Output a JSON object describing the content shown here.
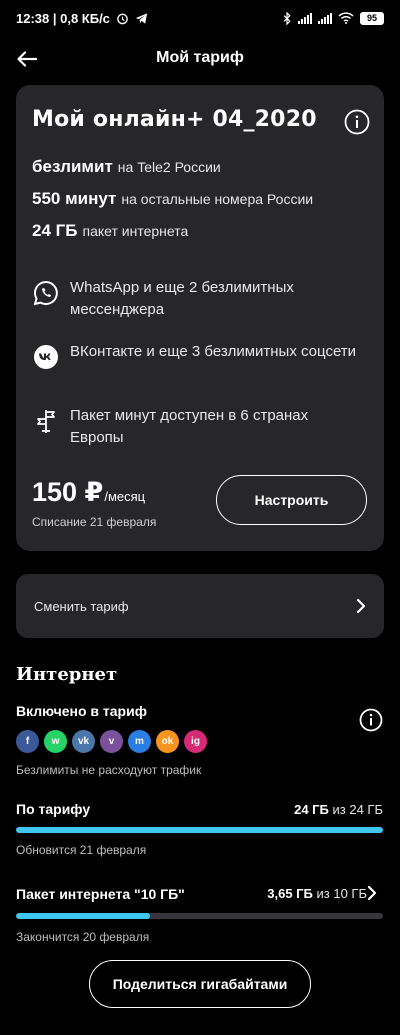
{
  "status_bar": {
    "time_speed": "12:38 | 0,8 КБ/с",
    "battery": "95"
  },
  "app_bar": {
    "title": "Мой тариф"
  },
  "plan": {
    "name": "Мой онлайн+ 04_2020",
    "features": [
      {
        "value": "безлимит",
        "desc": "на Tele2 России"
      },
      {
        "value": "550 минут",
        "desc": "на остальные номера России"
      },
      {
        "value": "24 ГБ",
        "desc": "пакет интернета"
      }
    ],
    "perks": [
      {
        "icon": "whatsapp-icon",
        "text": "WhatsApp и еще 2 безлимитных мессенджера"
      },
      {
        "icon": "vk-icon",
        "text": "ВКонтакте и еще 3 безлимитных соцсети"
      },
      {
        "icon": "flag-signpost-icon",
        "text": "Пакет минут доступен в 6 странах Европы"
      }
    ],
    "price": "150 ₽",
    "price_unit": "/месяц",
    "charge_date": "Списание 21 февраля",
    "configure_label": "Настроить"
  },
  "change_tariff": {
    "label": "Сменить тариф"
  },
  "internet": {
    "section_title": "Интернет",
    "included_title": "Включено в тариф",
    "socials": [
      {
        "name": "facebook",
        "glyph": "f",
        "color": "#3b5998"
      },
      {
        "name": "whatsapp",
        "glyph": "w",
        "color": "#25d366"
      },
      {
        "name": "vk",
        "glyph": "vk",
        "color": "#4a76a8"
      },
      {
        "name": "viber",
        "glyph": "v",
        "color": "#7b519d"
      },
      {
        "name": "messenger",
        "glyph": "m",
        "color": "#2a7de1"
      },
      {
        "name": "odnoklassniki",
        "glyph": "ok",
        "color": "#f7931e"
      },
      {
        "name": "instagram",
        "glyph": "ig",
        "color": "#d62976"
      }
    ],
    "note": "Безлимиты не расходуют трафик",
    "tariff_usage": {
      "title": "По тарифу",
      "used": "24 ГБ",
      "of_label": "из 24 ГБ",
      "fill_fraction": 1.0,
      "note": "Обновится 21 февраля"
    },
    "package_usage": {
      "title": "Пакет интернета \"10 ГБ\"",
      "used": "3,65 ГБ",
      "of_label": "из 10 ГБ",
      "fill_fraction": 0.365,
      "note": "Закончится 20 февраля"
    },
    "share_label": "Поделиться гигабайтами"
  },
  "colors": {
    "accent": "#3fc7f2",
    "card_bg": "#27272a",
    "background": "#000000"
  }
}
